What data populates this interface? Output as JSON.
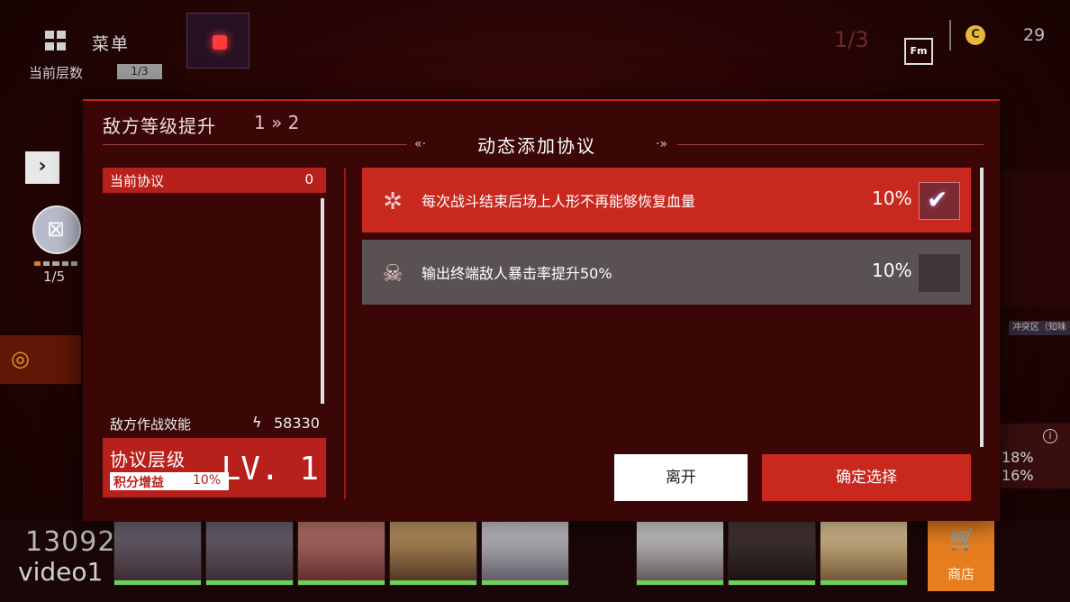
{
  "hud": {
    "menu_label": "菜单",
    "floor_label": "当前层数",
    "floor_count": "1/3",
    "top_right_floor": "1/3",
    "top_right_icon_text": "Fm",
    "coin_symbol": "C",
    "coin_count": "29",
    "avatar_count": "1/5",
    "right_tag": "冲突区（知味",
    "stat1": "18%",
    "stat2": "16%",
    "score": "13092",
    "video_label": "video1",
    "shop_label": "商店"
  },
  "dialog": {
    "title": "敌方等级提升",
    "level_change": "1 » 2",
    "heading": "动态添加协议",
    "current_protocol_label": "当前协议",
    "current_protocol_value": "0",
    "efficiency_label": "敌方作战效能",
    "efficiency_value": "58330",
    "protocol_level_label": "协议层级",
    "bonus_label": "积分增益",
    "bonus_value": "10%",
    "level_value": "LV. 1",
    "protocols": [
      {
        "text": "每次战斗结束后场上人形不再能够恢复血量",
        "percent": "10%",
        "selected": true
      },
      {
        "text": "输出终端敌人暴击率提升50%",
        "percent": "10%",
        "selected": false
      }
    ],
    "leave_label": "离开",
    "confirm_label": "确定选择"
  },
  "colors": {
    "accent_red": "#c8281e",
    "dialog_bg": "#3a0606",
    "unselected_row": "#5a5252",
    "shop_orange": "#e67e20"
  }
}
